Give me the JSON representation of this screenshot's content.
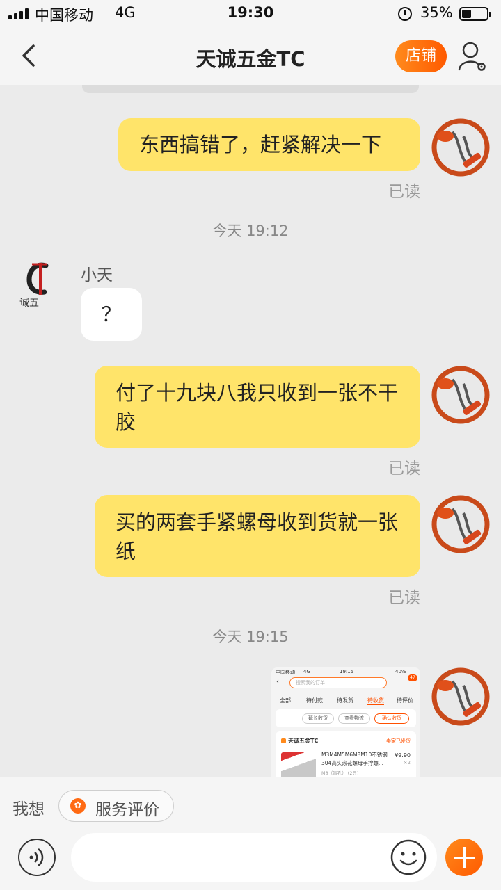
{
  "status_bar": {
    "carrier": "中国移动",
    "network": "4G",
    "time": "19:30",
    "battery": "35%"
  },
  "nav": {
    "title": "天诚五金TC",
    "shop_button": "店铺"
  },
  "messages": {
    "m1": {
      "text": "东西搞错了，赶紧解决一下",
      "status": "已读"
    },
    "ts1": "今天 19:12",
    "shop_sender": "小天",
    "shop_reply": "？",
    "m2": {
      "text": "付了十九块八我只收到一张不干胶",
      "status": "已读"
    },
    "m3": {
      "text": "买的两套手紧螺母收到货就一张纸",
      "status": "已读"
    },
    "ts2": "今天 19:15"
  },
  "screenshot": {
    "carrier": "中国移动",
    "network": "4G",
    "time": "19:15",
    "battery": "40%",
    "badge": "47",
    "search_placeholder": "搜索我的订单",
    "tabs": [
      "全部",
      "待付款",
      "待发货",
      "待收货",
      "待评价"
    ],
    "actions": [
      "延长收货",
      "查看物流",
      "确认收货"
    ],
    "shop_name": "天诚五金TC",
    "order_status": "卖家已发货",
    "product_title": "M3M4M5M6M8M10不锈钢304高头滚花螺母手拧螺...",
    "spec": "M8（盲孔） (2只)",
    "price": "¥9.90",
    "qty": "×2"
  },
  "bottom": {
    "prompt": "我想",
    "service_chip": "服务评价"
  },
  "colors": {
    "bubble_me": "#ffe46a",
    "accent": "#ff5a00",
    "background": "#ebebeb"
  }
}
